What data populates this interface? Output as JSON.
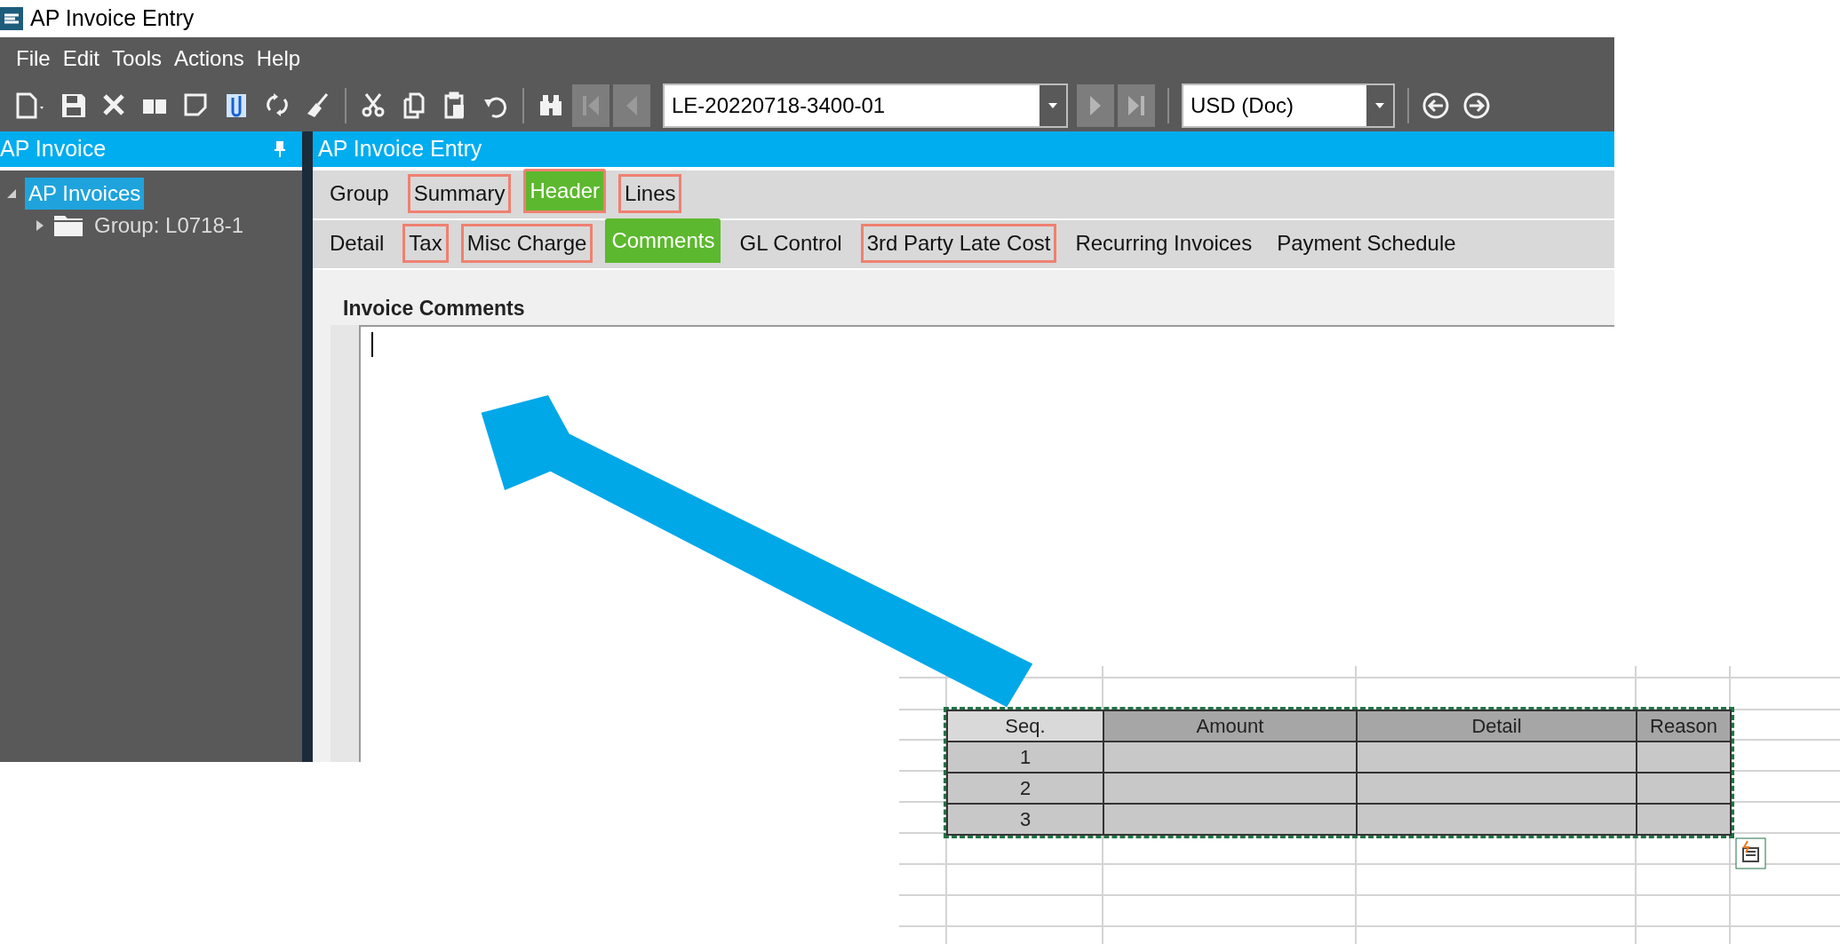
{
  "window": {
    "title": "AP Invoice Entry"
  },
  "menu": [
    "File",
    "Edit",
    "Tools",
    "Actions",
    "Help"
  ],
  "toolbar": {
    "record_field": {
      "value": "LE-20220718-3400-01"
    },
    "currency_field": {
      "value": "USD (Doc)"
    }
  },
  "left_panel": {
    "title": "AP Invoice",
    "tree": [
      {
        "label": "AP Invoices",
        "selected": true,
        "expanded": true,
        "children": [
          {
            "label": "Group: L0718-1",
            "selected": false,
            "expanded": false
          }
        ]
      }
    ]
  },
  "main_panel": {
    "title": "AP Invoice Entry",
    "tab_rows": [
      [
        {
          "label": "Group",
          "selected": false,
          "outlined": false
        },
        {
          "label": "Summary",
          "selected": false,
          "outlined": true
        },
        {
          "label": "Header",
          "selected": true,
          "outlined": true
        },
        {
          "label": "Lines",
          "selected": false,
          "outlined": true
        }
      ],
      [
        {
          "label": "Detail",
          "selected": false,
          "outlined": false
        },
        {
          "label": "Tax",
          "selected": false,
          "outlined": true
        },
        {
          "label": "Misc Charge",
          "selected": false,
          "outlined": true
        },
        {
          "label": "Comments",
          "selected": true,
          "outlined": false
        },
        {
          "label": "GL Control",
          "selected": false,
          "outlined": false
        },
        {
          "label": "3rd Party Late Cost",
          "selected": false,
          "outlined": true
        },
        {
          "label": "Recurring Invoices",
          "selected": false,
          "outlined": false
        },
        {
          "label": "Payment Schedule",
          "selected": false,
          "outlined": false
        }
      ]
    ],
    "comments": {
      "title": "Invoice Comments"
    }
  },
  "spreadsheet": {
    "columns": [
      "Seq.",
      "Amount",
      "Detail",
      "Reason"
    ],
    "rows": [
      {
        "seq": "1"
      },
      {
        "seq": "2"
      },
      {
        "seq": "3"
      }
    ]
  }
}
